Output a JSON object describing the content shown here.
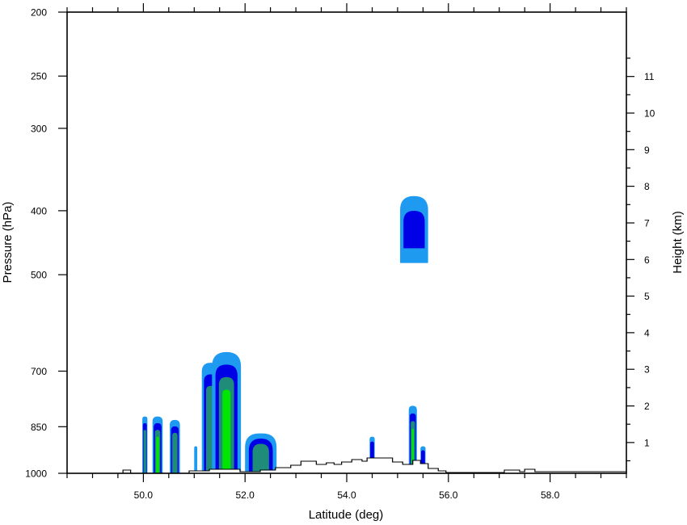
{
  "chart_data": {
    "type": "filled-contour cross-section",
    "xlabel": "Latitude (deg)",
    "ylabel_left": "Pressure (hPa)",
    "ylabel_right": "Height (km)",
    "xlim": [
      48.5,
      59.5
    ],
    "ylim_pressure": [
      1000,
      200
    ],
    "y_scale": "log (pressure)",
    "x_ticks": [
      {
        "value": 50,
        "label": "50.0"
      },
      {
        "value": 52,
        "label": "52.0"
      },
      {
        "value": 54,
        "label": "54.0"
      },
      {
        "value": 56,
        "label": "56.0"
      },
      {
        "value": 58,
        "label": "58.0"
      }
    ],
    "pressure_ticks": [
      {
        "value": 200,
        "label": "200"
      },
      {
        "value": 250,
        "label": "250"
      },
      {
        "value": 300,
        "label": "300"
      },
      {
        "value": 400,
        "label": "400"
      },
      {
        "value": 500,
        "label": "500"
      },
      {
        "value": 700,
        "label": "700"
      },
      {
        "value": 850,
        "label": "850"
      },
      {
        "value": 1000,
        "label": "1000"
      }
    ],
    "height_ticks": [
      {
        "value": 1,
        "label": "1"
      },
      {
        "value": 2,
        "label": "2"
      },
      {
        "value": 3,
        "label": "3"
      },
      {
        "value": 4,
        "label": "4"
      },
      {
        "value": 5,
        "label": "5"
      },
      {
        "value": 6,
        "label": "6"
      },
      {
        "value": 7,
        "label": "7"
      },
      {
        "value": 8,
        "label": "8"
      },
      {
        "value": 9,
        "label": "9"
      },
      {
        "value": 10,
        "label": "10"
      },
      {
        "value": 11,
        "label": "11"
      }
    ],
    "contour_levels_colors": [
      "#1e9bf0",
      "#0000e6",
      "#1e8c78",
      "#00e600",
      "#00a000",
      "#e6dc32"
    ],
    "cloud_regions": [
      {
        "name": "cell-50.0",
        "lat": [
          49.98,
          50.08
        ],
        "p_top": 820,
        "layers": [
          "#1e9bf0",
          "#0000e6",
          "#1e8c78",
          "#00e600"
        ]
      },
      {
        "name": "cell-50.3",
        "lat": [
          50.18,
          50.38
        ],
        "p_top": 820,
        "layers": [
          "#1e9bf0",
          "#0000e6",
          "#1e8c78",
          "#00e600"
        ]
      },
      {
        "name": "cell-50.6",
        "lat": [
          50.52,
          50.72
        ],
        "p_top": 830,
        "layers": [
          "#1e9bf0",
          "#0000e6",
          "#1e8c78"
        ]
      },
      {
        "name": "cell-51.0",
        "lat": [
          51.0,
          51.06
        ],
        "p_top": 910,
        "layers": [
          "#1e9bf0"
        ]
      },
      {
        "name": "cell-51.3",
        "lat": [
          51.15,
          51.5
        ],
        "p_top": 680,
        "layers": [
          "#1e9bf0",
          "#0000e6",
          "#1e8c78"
        ]
      },
      {
        "name": "cell-51.6",
        "lat": [
          51.35,
          51.92
        ],
        "p_top": 655,
        "layers": [
          "#1e9bf0",
          "#0000e6",
          "#1e8c78",
          "#00e600",
          "#00a000",
          "#e6dc32"
        ]
      },
      {
        "name": "cell-52.3",
        "lat": [
          52.0,
          52.62
        ],
        "p_top": 870,
        "layers": [
          "#1e9bf0",
          "#0000e6",
          "#1e8c78"
        ]
      },
      {
        "name": "cell-54.5",
        "lat": [
          54.45,
          54.55
        ],
        "p_top": 880,
        "layers": [
          "#1e9bf0",
          "#0000e6"
        ]
      },
      {
        "name": "cell-55.3",
        "lat": [
          55.22,
          55.38
        ],
        "p_top": 790,
        "layers": [
          "#1e9bf0",
          "#0000e6",
          "#1e8c78",
          "#00e600"
        ]
      },
      {
        "name": "cell-55.5",
        "lat": [
          55.45,
          55.55
        ],
        "p_top": 910,
        "layers": [
          "#1e9bf0",
          "#0000e6"
        ]
      },
      {
        "name": "upper-cloud-55.4",
        "lat": [
          55.05,
          55.6
        ],
        "p_range": [
          380,
          480
        ],
        "layers": [
          "#1e9bf0",
          "#0000e6"
        ]
      }
    ],
    "terrain_note": "step profile of surface along bottom edge, rising between ~53.0 and ~55.8"
  }
}
